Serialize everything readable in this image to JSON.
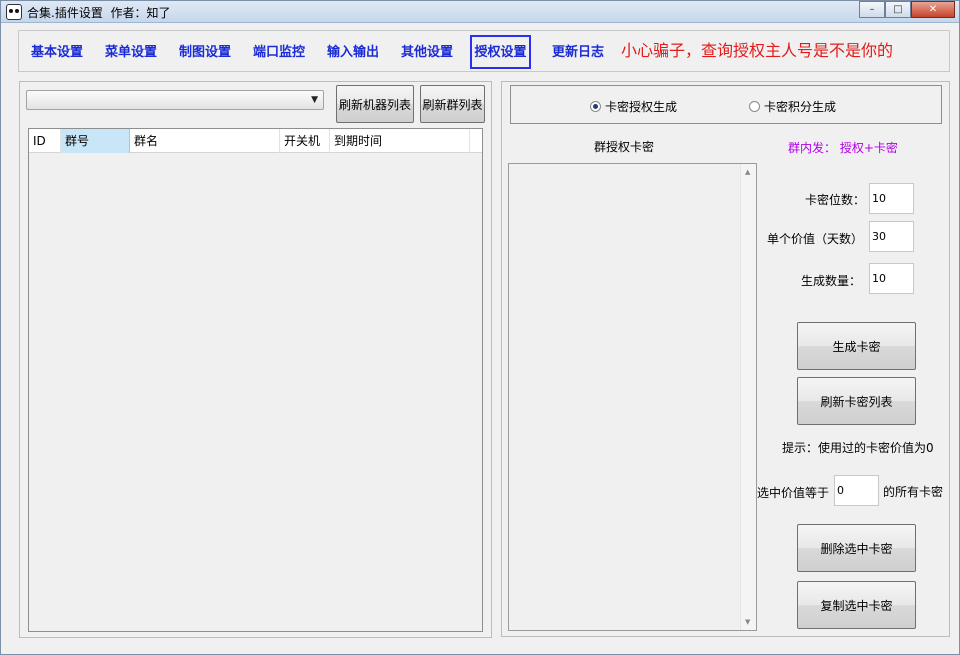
{
  "titlebar": {
    "title": "合集.插件设置  作者：知了",
    "minimize": "–",
    "maximize": "□",
    "close": "✕"
  },
  "tabs": [
    {
      "label": "基本设置"
    },
    {
      "label": "菜单设置"
    },
    {
      "label": "制图设置"
    },
    {
      "label": "端口监控"
    },
    {
      "label": "输入输出"
    },
    {
      "label": "其他设置"
    },
    {
      "label": "授权设置"
    },
    {
      "label": "更新日志"
    }
  ],
  "warning_text": "小心骗子，查询授权主人号是不是你的",
  "left_panel": {
    "combo_value": "",
    "refresh_robots_button": "刷新机器列表",
    "refresh_groups_button": "刷新群列表",
    "grid_columns": [
      "ID",
      "群号",
      "群名",
      "开关机",
      "到期时间"
    ]
  },
  "right_panel": {
    "radio_options": [
      "卡密授权生成",
      "卡密积分生成"
    ],
    "list_title": "群授权卡密",
    "in_group_hint": "群内发： 授权+卡密",
    "card_digits_label": "卡密位数：",
    "card_digits_value": "10",
    "unit_value_label": "单个价值（天数）",
    "unit_value_value": "30",
    "generate_count_label": "生成数量：",
    "generate_count_value": "10",
    "generate_button": "生成卡密",
    "refresh_cards_button": "刷新卡密列表",
    "tip_text": "提示：使用过的卡密价值为0",
    "select_value_label": "选中价值等于",
    "select_value_value": "0",
    "select_value_suffix": "的所有卡密",
    "delete_button": "删除选中卡密",
    "copy_button": "复制选中卡密"
  }
}
